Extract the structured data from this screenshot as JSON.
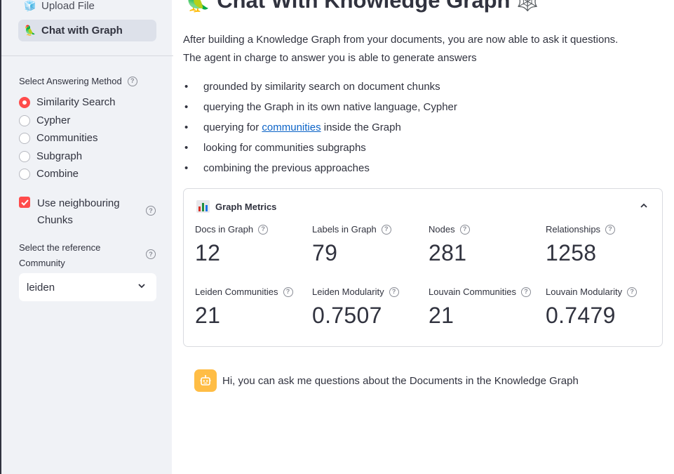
{
  "sidebar": {
    "nav": [
      {
        "icon": "cube-icon",
        "emoji": "🧊",
        "label": "Upload File"
      },
      {
        "icon": "parrot-icon",
        "emoji": "🦜",
        "label": "Chat with Graph"
      }
    ],
    "answering_method": {
      "label": "Select Answering Method",
      "options": [
        "Similarity Search",
        "Cypher",
        "Communities",
        "Subgraph",
        "Combine"
      ],
      "selected": "Similarity Search"
    },
    "neighbouring": {
      "label": "Use neighbouring Chunks",
      "checked": true
    },
    "reference_community": {
      "label": "Select the reference Community",
      "value": "leiden"
    }
  },
  "main": {
    "title_emoji": "🦜",
    "title": "Chat With Knowledge Graph",
    "title_trailing_icon": "🕸️",
    "intro_line1": "After building a Knowledge Graph from your documents, you are now able to ask it questions.",
    "intro_line2": "The agent in charge to answer you is able to generate answers",
    "bullets": [
      {
        "pre": "grounded by similarity search on document chunks"
      },
      {
        "pre": "querying the Graph in its own native language, Cypher"
      },
      {
        "pre": "querying for ",
        "link": "communities",
        "post": " inside the Graph"
      },
      {
        "pre": "looking for communities subgraphs"
      },
      {
        "pre": "combining the previous approaches"
      }
    ],
    "metrics": {
      "title": "Graph Metrics",
      "items": [
        {
          "label": "Docs in Graph",
          "value": "12"
        },
        {
          "label": "Labels in Graph",
          "value": "79"
        },
        {
          "label": "Nodes",
          "value": "281"
        },
        {
          "label": "Relationships",
          "value": "1258"
        },
        {
          "label": "Leiden Communities",
          "value": "21"
        },
        {
          "label": "Leiden Modularity",
          "value": "0.7507"
        },
        {
          "label": "Louvain Communities",
          "value": "21"
        },
        {
          "label": "Louvain Modularity",
          "value": "0.7479"
        }
      ]
    },
    "chat": {
      "message": "Hi, you can ask me questions about the Documents in the Knowledge Graph"
    }
  },
  "colors": {
    "accent": "#ff4b4b",
    "sidebar_bg": "#f0f2f6",
    "bot_avatar": "#ffbd45",
    "link": "#0b63c7"
  }
}
